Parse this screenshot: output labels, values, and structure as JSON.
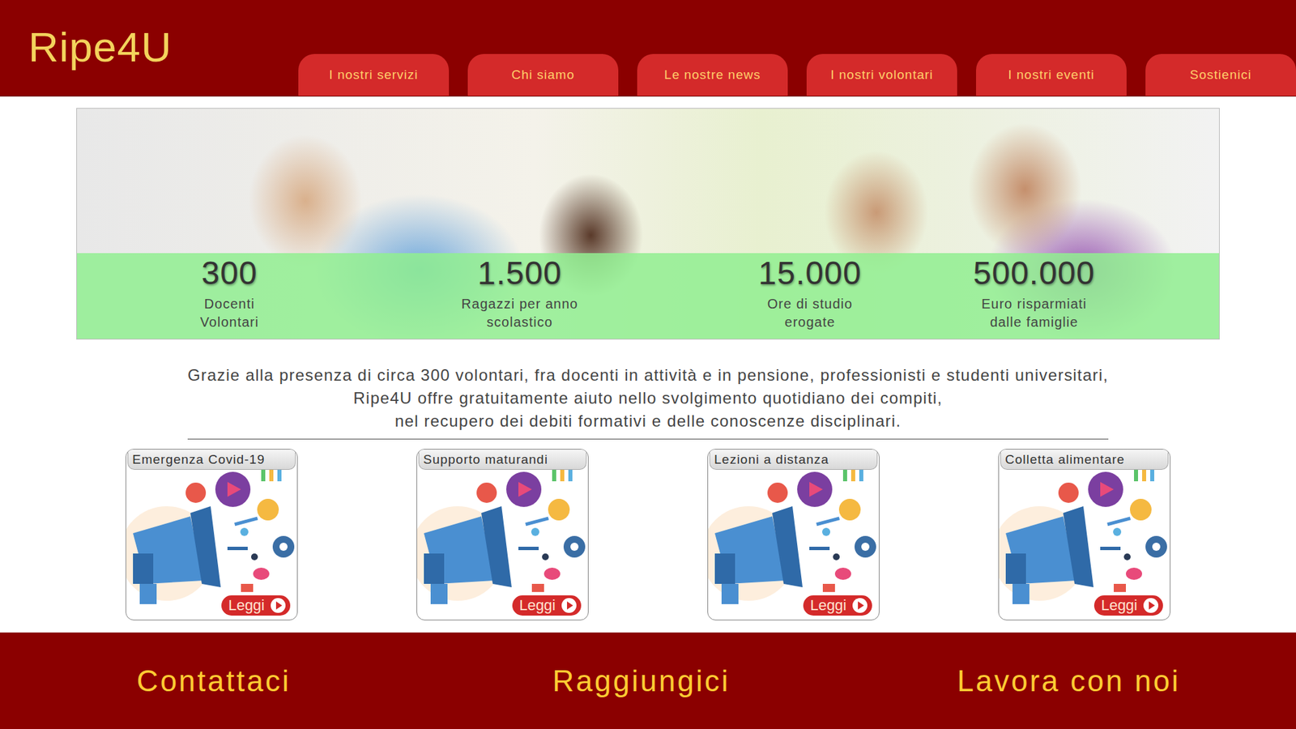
{
  "header": {
    "logo": "Ripe4U"
  },
  "nav": [
    {
      "label": "I nostri servizi"
    },
    {
      "label": "Chi siamo"
    },
    {
      "label": "Le nostre news"
    },
    {
      "label": "I nostri volontari"
    },
    {
      "label": "I nostri eventi"
    },
    {
      "label": "Sostienici"
    }
  ],
  "hero": {
    "stats": [
      {
        "value": "300",
        "label": [
          "Docenti",
          "Volontari"
        ]
      },
      {
        "value": "1.500",
        "label": [
          "Ragazzi per anno",
          "scolastico"
        ]
      },
      {
        "value": "15.000",
        "label": [
          "Ore di studio",
          "erogate"
        ]
      },
      {
        "value": "500.000",
        "label": [
          "Euro risparmiati",
          "dalle famiglie"
        ]
      }
    ]
  },
  "intro": {
    "lines": [
      "Grazie alla presenza di circa 300 volontari, fra docenti in attività e in pensione, professionisti e studenti universitari,",
      "Ripe4U offre gratuitamente aiuto nello svolgimento quotidiano dei compiti,",
      "nel recupero dei debiti formativi e delle conoscenze disciplinari."
    ]
  },
  "cards": [
    {
      "title": "Emergenza Covid-19",
      "button": "Leggi"
    },
    {
      "title": "Supporto maturandi",
      "button": "Leggi"
    },
    {
      "title": "Lezioni a distanza",
      "button": "Leggi"
    },
    {
      "title": "Colletta alimentare",
      "button": "Leggi"
    }
  ],
  "footer": {
    "links": [
      "Contattaci",
      "Raggiungici",
      "Lavora con noi"
    ]
  }
}
